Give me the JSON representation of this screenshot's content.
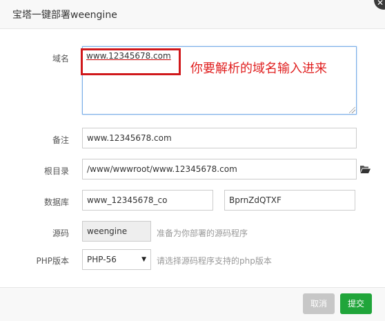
{
  "dialog": {
    "title": "宝塔一键部署weengine",
    "close_glyph": "✕"
  },
  "form": {
    "domain": {
      "label": "域名",
      "value": "www.12345678.com"
    },
    "annotation": "你要解析的域名输入进来",
    "remark": {
      "label": "备注",
      "value": "www.12345678.com"
    },
    "root_dir": {
      "label": "根目录",
      "value": "/www/wwwroot/www.12345678.com",
      "icon": "folder-open-icon"
    },
    "database": {
      "label": "数据库",
      "name_value": "www_12345678_co",
      "password_value": "BprnZdQTXF"
    },
    "source": {
      "label": "源码",
      "value": "weengine",
      "hint": "准备为你部署的源码程序"
    },
    "php_version": {
      "label": "PHP版本",
      "selected": "PHP-56",
      "hint": "请选择源码程序支持的php版本"
    }
  },
  "footer": {
    "cancel_label": "取消",
    "submit_label": "提交"
  },
  "colors": {
    "submit": "#20a53a",
    "cancel": "#c7c7c7",
    "annotation": "#e02020",
    "focus_border": "#7aaee8"
  }
}
